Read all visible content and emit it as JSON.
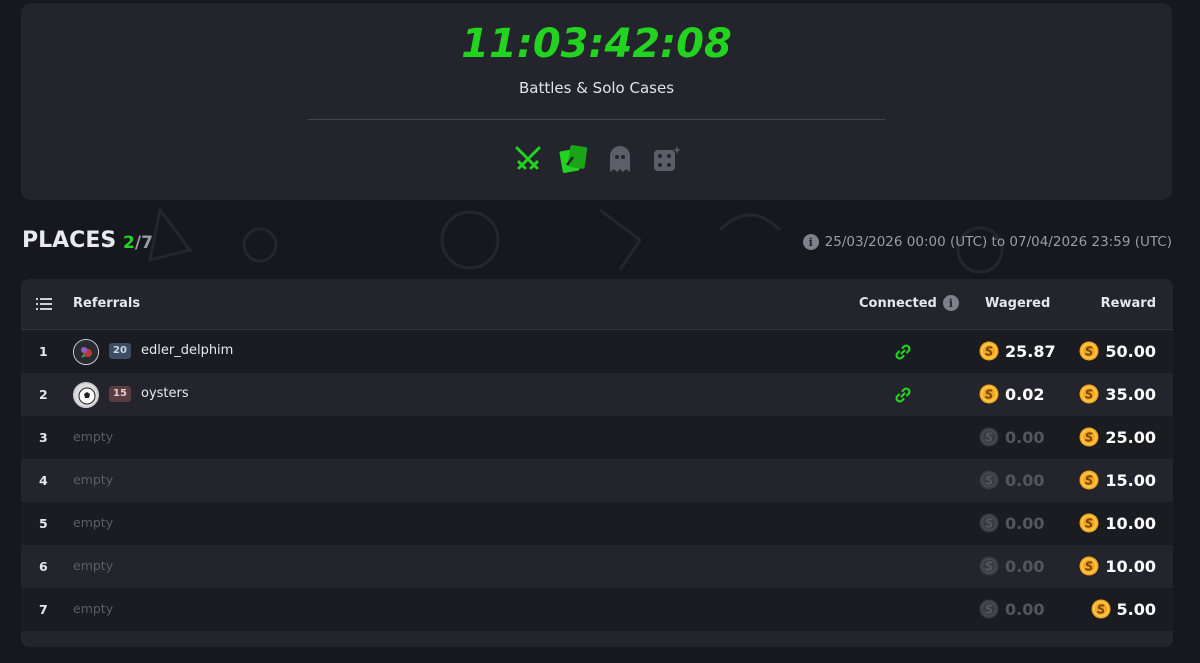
{
  "colors": {
    "accent": "#22d420",
    "background": "#17171e",
    "card": "#24242d",
    "coin": "#f5a623"
  },
  "header": {
    "timer": "11:03:42:08",
    "subtitle": "Battles & Solo Cases",
    "game_icons": [
      "crossed-swords-icon",
      "cards-icon",
      "ghost-icon",
      "dice-icon"
    ]
  },
  "places": {
    "title": "PLACES",
    "dash": "-",
    "current": "2",
    "separator": "/",
    "total": "7",
    "date_range": "25/03/2026 00:00 (UTC) to 07/04/2026 23:59 (UTC)"
  },
  "table": {
    "headers": {
      "referrals": "Referrals",
      "connected": "Connected",
      "wagered": "Wagered",
      "reward": "Reward"
    },
    "rows": [
      {
        "rank": "1",
        "level": "20",
        "username": "edler_delphim",
        "connected": true,
        "wagered": "25.87",
        "reward": "50.00"
      },
      {
        "rank": "2",
        "level": "15",
        "username": "oysters",
        "connected": true,
        "wagered": "0.02",
        "reward": "35.00"
      },
      {
        "rank": "3",
        "empty": "empty",
        "wagered": "0.00",
        "reward": "25.00"
      },
      {
        "rank": "4",
        "empty": "empty",
        "wagered": "0.00",
        "reward": "15.00"
      },
      {
        "rank": "5",
        "empty": "empty",
        "wagered": "0.00",
        "reward": "10.00"
      },
      {
        "rank": "6",
        "empty": "empty",
        "wagered": "0.00",
        "reward": "10.00"
      },
      {
        "rank": "7",
        "empty": "empty",
        "wagered": "0.00",
        "reward": "5.00"
      }
    ]
  }
}
